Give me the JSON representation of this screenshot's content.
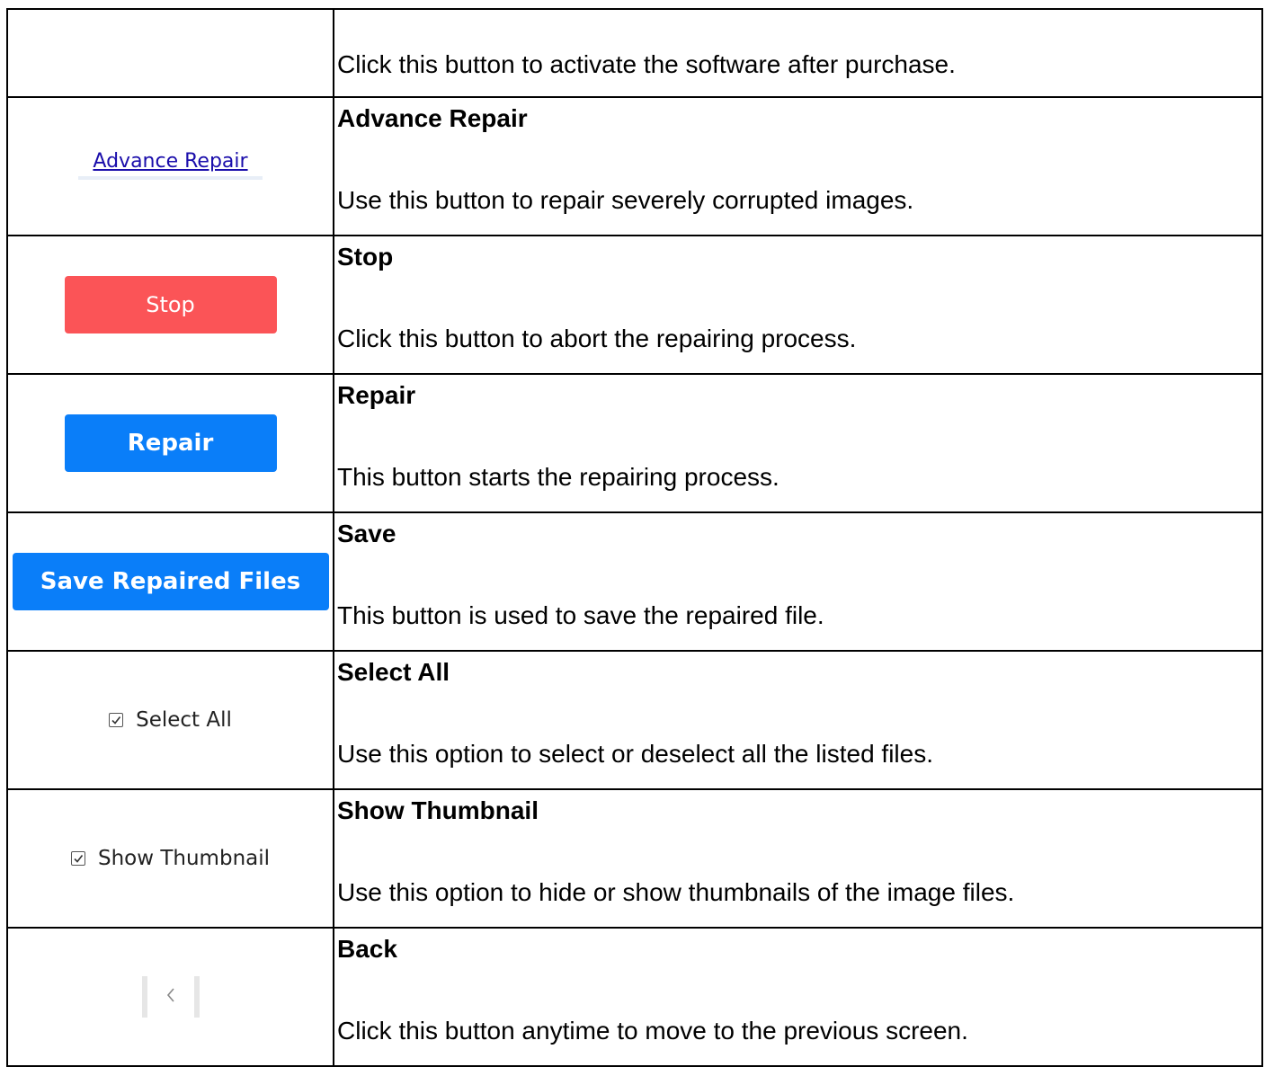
{
  "rows": [
    {
      "title": "",
      "text": "Click this button to activate the software after purchase."
    },
    {
      "control_label": "Advance Repair",
      "title": "Advance Repair",
      "text": "Use this button to repair severely corrupted images."
    },
    {
      "control_label": "Stop",
      "title": "Stop",
      "text": "Click this button to abort the repairing process."
    },
    {
      "control_label": "Repair",
      "title": "Repair",
      "text": "This button starts the repairing process."
    },
    {
      "control_label": "Save Repaired Files",
      "title": "Save",
      "text": "This button is used to save the repaired file."
    },
    {
      "control_label": "Select All",
      "title": "Select All",
      "text": "Use this option to select or deselect all the listed files."
    },
    {
      "control_label": "Show Thumbnail",
      "title": "Show Thumbnail",
      "text": "Use this option to hide or show thumbnails of the image files."
    },
    {
      "title": "Back",
      "text": "Click this button anytime to move to the previous screen."
    }
  ],
  "icons": {
    "checkbox": "checkbox-checked-icon",
    "back": "chevron-left-icon"
  },
  "colors": {
    "stop_button": "#fb5457",
    "primary_button": "#0a7ef9",
    "link": "#1a0dab"
  }
}
